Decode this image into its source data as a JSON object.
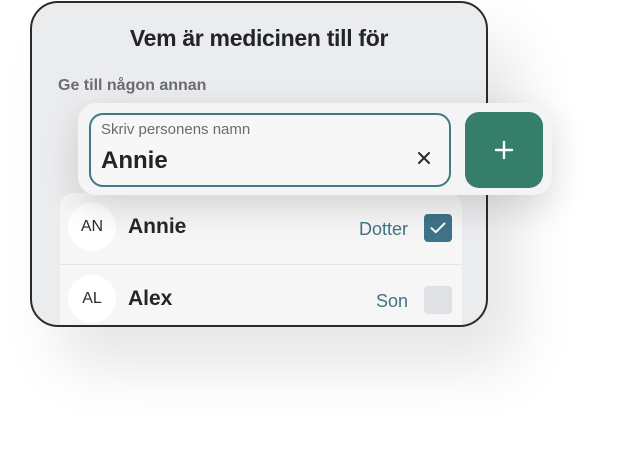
{
  "header": {
    "title": "Vem är medicinen till för"
  },
  "section": {
    "subtitle": "Ge till någon annan"
  },
  "name_input": {
    "placeholder": "Skriv personens namn",
    "value": "Annie",
    "clear_icon": "close-icon"
  },
  "add_button": {
    "icon": "plus-icon",
    "color": "#347e6a"
  },
  "people": [
    {
      "initials": "AN",
      "name": "Annie",
      "relation": "Dotter",
      "checked": true
    },
    {
      "initials": "AL",
      "name": "Alex",
      "relation": "Son",
      "checked": false
    }
  ],
  "colors": {
    "accent": "#3f7a86",
    "checkbox_checked": "#3e7389",
    "relation_text": "#3f7480"
  }
}
